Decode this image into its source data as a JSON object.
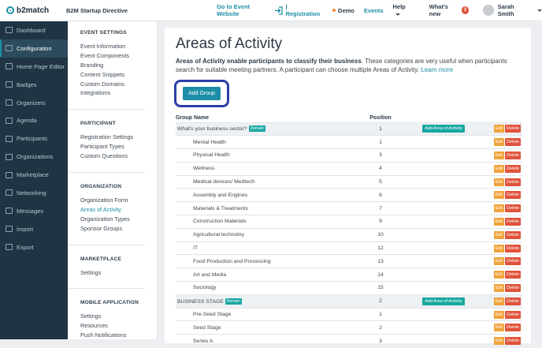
{
  "app": {
    "brand": "b2match",
    "event_title": "B2M Startup Directive"
  },
  "topnav": {
    "go_to_event": "Go to Event Website",
    "registration": "| Registration",
    "demo": "Demo",
    "events": "Events",
    "help": "Help",
    "whats_new": "What's new",
    "whats_new_count": "3",
    "user_name": "Sarah Smith"
  },
  "sidebar": {
    "items": [
      {
        "label": "Dashboard",
        "icon": "dashboard-icon"
      },
      {
        "label": "Configuration",
        "icon": "gear-icon",
        "active": true
      },
      {
        "label": "Home Page Editor",
        "icon": "page-icon"
      },
      {
        "label": "Badges",
        "icon": "badge-icon"
      },
      {
        "label": "Organizers",
        "icon": "user-icon"
      },
      {
        "label": "Agenda",
        "icon": "calendar-icon"
      },
      {
        "label": "Participants",
        "icon": "users-icon"
      },
      {
        "label": "Organizations",
        "icon": "building-icon"
      },
      {
        "label": "Marketplace",
        "icon": "store-icon"
      },
      {
        "label": "Networking",
        "icon": "network-icon"
      },
      {
        "label": "Messages",
        "icon": "mail-icon"
      },
      {
        "label": "Import",
        "icon": "import-icon"
      },
      {
        "label": "Export",
        "icon": "export-icon"
      }
    ]
  },
  "subnav": {
    "sections": [
      {
        "title": "EVENT SETTINGS",
        "links": [
          "Event Information",
          "Event Components",
          "Branding",
          "Content Snippets",
          "Custom Domains",
          "Integrations"
        ]
      },
      {
        "title": "PARTICIPANT",
        "links": [
          "Registration Settings",
          "Participant Types",
          "Custom Questions"
        ]
      },
      {
        "title": "ORGANIZATION",
        "links": [
          "Organization Form",
          "Areas of Activity",
          "Organization Types",
          "Sponsor Groups"
        ]
      },
      {
        "title": "MARKETPLACE",
        "links": [
          "Settings"
        ]
      },
      {
        "title": "MOBILE APPLICATION",
        "links": [
          "Settings",
          "Resources",
          "Push Notifications"
        ]
      }
    ],
    "active_link": "Areas of Activity"
  },
  "main": {
    "title": "Areas of Activity",
    "intro_bold": "Areas of Activity enable participants to classify their business",
    "intro_rest": ". These categories are very useful when participants search for suitable meeting partners. A participant can choose multiple Areas of Activity.",
    "learn_more": "Learn more",
    "add_group": "Add Group",
    "table": {
      "col_name": "Group Name",
      "col_position": "Position",
      "domain_badge": "Domain",
      "add_area": "Add Area of Activity",
      "edit": "Edit",
      "delete": "Delete",
      "rows": [
        {
          "name": "What's your business sector?",
          "position": "1",
          "group": true
        },
        {
          "name": "Mental Health",
          "position": "1"
        },
        {
          "name": "Physical Health",
          "position": "3"
        },
        {
          "name": "Wellness",
          "position": "4"
        },
        {
          "name": "Medical devices/ Medtech",
          "position": "5"
        },
        {
          "name": "Assembly and Engines",
          "position": "6"
        },
        {
          "name": "Materials & Treatments",
          "position": "7"
        },
        {
          "name": "Construction Materials",
          "position": "9"
        },
        {
          "name": "Agricultural technoloy",
          "position": "10"
        },
        {
          "name": "IT",
          "position": "12"
        },
        {
          "name": "Food Production and Processing",
          "position": "13"
        },
        {
          "name": "Art and Media",
          "position": "14"
        },
        {
          "name": "Sociology",
          "position": "15"
        },
        {
          "name": "BUSINESS STAGE",
          "position": "2",
          "group": true
        },
        {
          "name": "Pre-Seed Stage",
          "position": "1"
        },
        {
          "name": "Seed Stage",
          "position": "2"
        },
        {
          "name": "Series A",
          "position": "3"
        }
      ]
    }
  }
}
